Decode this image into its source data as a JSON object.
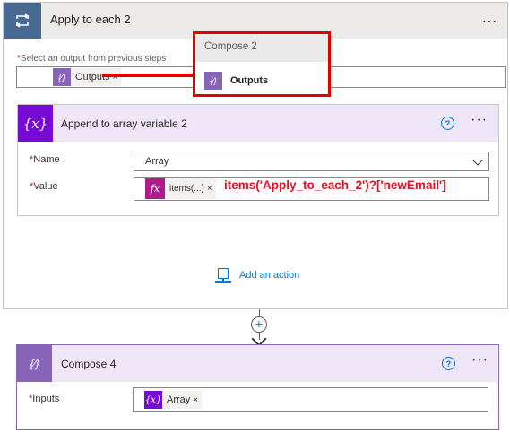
{
  "loop": {
    "title": "Apply to each 2",
    "menu": "…",
    "select_label": "Select an output from previous steps",
    "required_mark": "*",
    "token": {
      "label": "Outputs",
      "remove": "×",
      "icon": "compose-icon"
    }
  },
  "append": {
    "title": "Append to array variable 2",
    "icon": "variable-icon",
    "icon_glyph": "{x}",
    "help": "?",
    "menu": "···",
    "name_label": "Name",
    "name_value": "Array",
    "value_label": "Value",
    "value_token": {
      "label": "items(...)",
      "remove": "×",
      "icon_glyph": "fx"
    },
    "expression": "items('Apply_to_each_2')?['newEmail']"
  },
  "add_action": {
    "label": "Add an action"
  },
  "connector": {
    "plus": "+"
  },
  "compose4": {
    "title": "Compose 4",
    "icon": "compose-icon",
    "icon_glyph": "{∕}",
    "help": "?",
    "menu": "···",
    "inputs_label": "Inputs",
    "token": {
      "label": "Array",
      "remove": "×",
      "icon_glyph": "{x}"
    }
  },
  "callout": {
    "title": "Compose 2",
    "token_label": "Outputs",
    "icon_glyph": "{∕}"
  },
  "colors": {
    "loop_header_icon": "#486991",
    "variable_purple": "#770bd6",
    "compose_purple": "#8764b8",
    "expression_magenta": "#ae1c8b",
    "annotation_red": "#e00000",
    "link_blue": "#0078d4"
  }
}
